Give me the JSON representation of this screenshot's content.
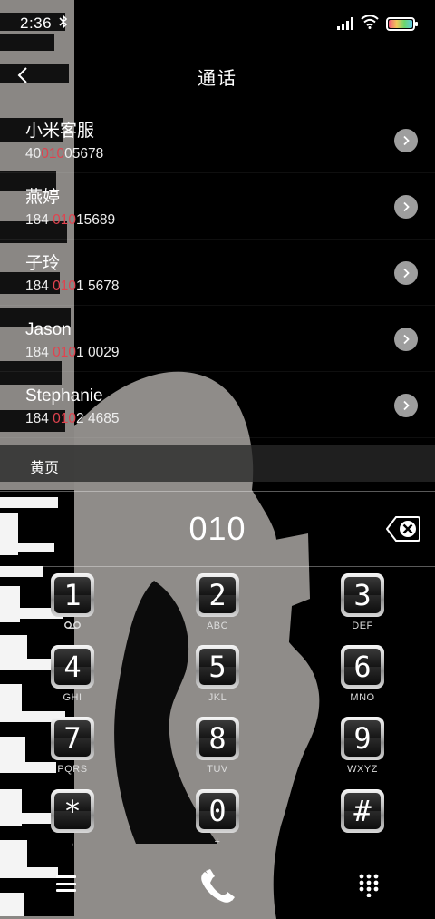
{
  "status_bar": {
    "time": "2:36",
    "bluetooth_icon": "bluetooth-icon",
    "signal_icon": "signal-icon",
    "wifi_icon": "wifi-icon",
    "battery_icon": "battery-icon"
  },
  "header": {
    "title": "通话",
    "back_icon": "chevron-left-icon"
  },
  "contacts": [
    {
      "name": "小米客服",
      "num_pre": "40",
      "num_hl": "010",
      "num_post": "05678"
    },
    {
      "name": "燕婷",
      "num_pre": "184 ",
      "num_hl": "010",
      "num_post": "15689"
    },
    {
      "name": "子玲",
      "num_pre": "184 ",
      "num_hl": "010",
      "num_post": "1 5678"
    },
    {
      "name": "Jason",
      "num_pre": "184 ",
      "num_hl": "010",
      "num_post": "1 0029"
    },
    {
      "name": "Stephanie",
      "num_pre": "184 ",
      "num_hl": "010",
      "num_post": "2 4685"
    }
  ],
  "section_label": "黄页",
  "dialer": {
    "input": "010",
    "keys": [
      {
        "digit": "1",
        "sub": "voicemail"
      },
      {
        "digit": "2",
        "sub": "ABC"
      },
      {
        "digit": "3",
        "sub": "DEF"
      },
      {
        "digit": "4",
        "sub": "GHI"
      },
      {
        "digit": "5",
        "sub": "JKL"
      },
      {
        "digit": "6",
        "sub": "MNO"
      },
      {
        "digit": "7",
        "sub": "PQRS"
      },
      {
        "digit": "8",
        "sub": "TUV"
      },
      {
        "digit": "9",
        "sub": "WXYZ"
      },
      {
        "digit": "*",
        "sub": ","
      },
      {
        "digit": "0",
        "sub": "+"
      },
      {
        "digit": "#",
        "sub": ""
      }
    ]
  },
  "colors": {
    "highlight": "#e0434f",
    "background": "#000000",
    "arrow_button": "#9e9e9e"
  }
}
